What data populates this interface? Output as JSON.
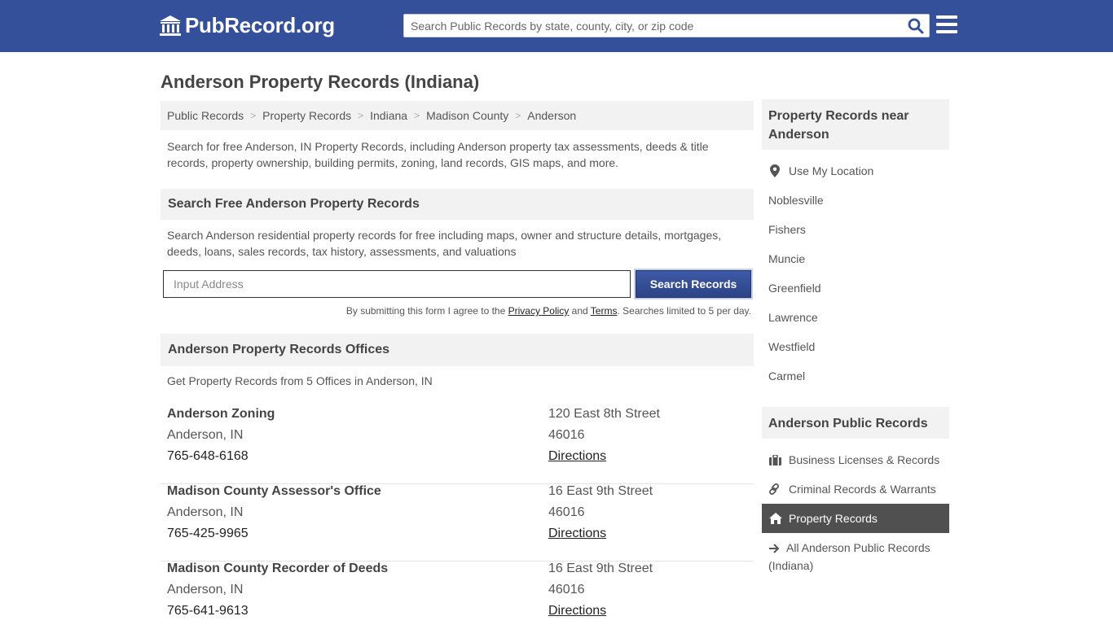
{
  "header": {
    "logo_text": "PubRecord.org",
    "search_placeholder": "Search Public Records by state, county, city, or zip code",
    "brand_color": "#35509a"
  },
  "page_title": "Anderson Property Records (Indiana)",
  "breadcrumb": [
    "Public Records",
    "Property Records",
    "Indiana",
    "Madison County",
    "Anderson"
  ],
  "intro": "Search for free Anderson, IN Property Records, including Anderson property tax assessments, deeds & title records, property ownership, building permits, zoning, land records, GIS maps, and more.",
  "search_section": {
    "heading": "Search Free Anderson Property Records",
    "description": "Search Anderson residential property records for free including maps, owner and structure details, mortgages, deeds, loans, sales records, tax history, assessments, and valuations",
    "input_placeholder": "Input Address",
    "button_label": "Search Records",
    "agree_prefix": "By submitting this form I agree to the ",
    "privacy_label": "Privacy Policy",
    "and_text": " and ",
    "terms_label": "Terms",
    "agree_suffix": ". Searches limited to 5 per day."
  },
  "offices_section": {
    "heading": "Anderson Property Records Offices",
    "subtitle": "Get Property Records from 5 Offices in Anderson, IN",
    "offices": [
      {
        "name": "Anderson Zoning",
        "city": "Anderson, IN",
        "phone": "765-648-6168",
        "street": "120 East 8th Street",
        "zip": "46016",
        "directions": "Directions"
      },
      {
        "name": "Madison County Assessor's Office",
        "city": "Anderson, IN",
        "phone": "765-425-9965",
        "street": "16 East 9th Street",
        "zip": "46016",
        "directions": "Directions"
      },
      {
        "name": "Madison County Recorder of Deeds",
        "city": "Anderson, IN",
        "phone": "765-641-9613",
        "street": "16 East 9th Street",
        "zip": "46016",
        "directions": "Directions"
      }
    ]
  },
  "sidebar": {
    "nearby_heading": "Property Records near Anderson",
    "use_location": "Use My Location",
    "nearby": [
      "Noblesville",
      "Fishers",
      "Muncie",
      "Greenfield",
      "Lawrence",
      "Westfield",
      "Carmel"
    ],
    "public_heading": "Anderson Public Records",
    "public_links": [
      {
        "label": "Business Licenses & Records",
        "icon": "briefcase-icon"
      },
      {
        "label": "Criminal Records & Warrants",
        "icon": "link-icon"
      },
      {
        "label": "Property Records",
        "icon": "home-icon",
        "active": true
      },
      {
        "label": "All Anderson Public Records (Indiana)",
        "icon": "arrow-right-icon"
      }
    ]
  }
}
